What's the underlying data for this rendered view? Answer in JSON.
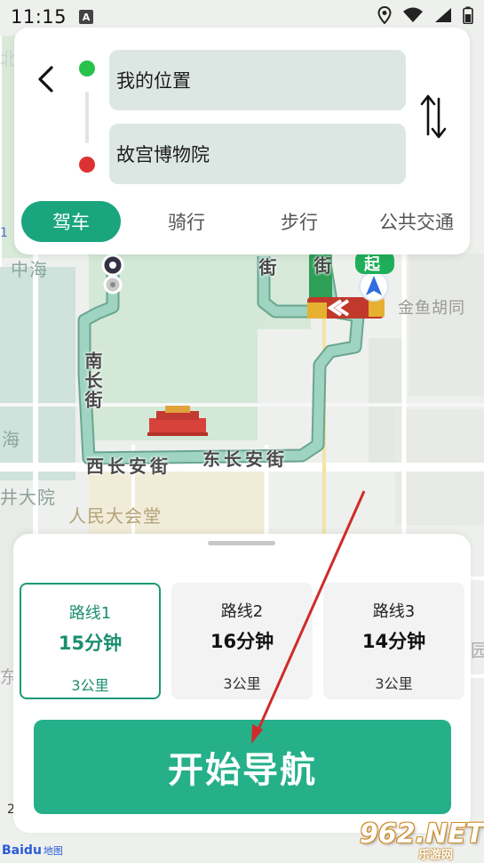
{
  "status_bar": {
    "time": "11:15",
    "notification_icon_letter": "A",
    "icons": [
      "location-icon",
      "wifi-icon",
      "signal-icon",
      "battery-icon"
    ]
  },
  "route_card": {
    "start_location": "我的位置",
    "end_location": "故宫博物院",
    "start_dot_color": "#27c24c",
    "end_dot_color": "#dc3232",
    "modes": [
      {
        "label": "驾车",
        "active": true
      },
      {
        "label": "骑行",
        "active": false
      },
      {
        "label": "步行",
        "active": false
      },
      {
        "label": "公共交通",
        "active": false
      }
    ]
  },
  "map": {
    "labels": {
      "zhonghai": "中海",
      "hai": "海",
      "bei": "北",
      "dayuan": "井大院",
      "renmin_dahuitang": "人民大会堂",
      "jinyu_hutong": "金鱼胡同",
      "xi_changan": "西长安街",
      "dong_changan": "东长安街",
      "nanchang": "南长街",
      "jie": "街",
      "dong": "东",
      "yuan": "园",
      "qi_badge": "起",
      "edge_one": "1",
      "edge_two": "2"
    },
    "route_color": "#8ecbb8"
  },
  "bottom_panel": {
    "routes": [
      {
        "name": "路线1",
        "time": "15分钟",
        "distance": "3公里",
        "selected": true
      },
      {
        "name": "路线2",
        "time": "16分钟",
        "distance": "3公里",
        "selected": false
      },
      {
        "name": "路线3",
        "time": "14分钟",
        "distance": "3公里",
        "selected": false
      }
    ],
    "start_button_label": "开始导航"
  },
  "branding": {
    "baidu_logo": "Baidu",
    "baidu_map": "地图",
    "watermark": "962.NET",
    "watermark_sub": "乐游网"
  },
  "colors": {
    "accent": "#25b08a",
    "selected_border": "#1a9a78"
  }
}
